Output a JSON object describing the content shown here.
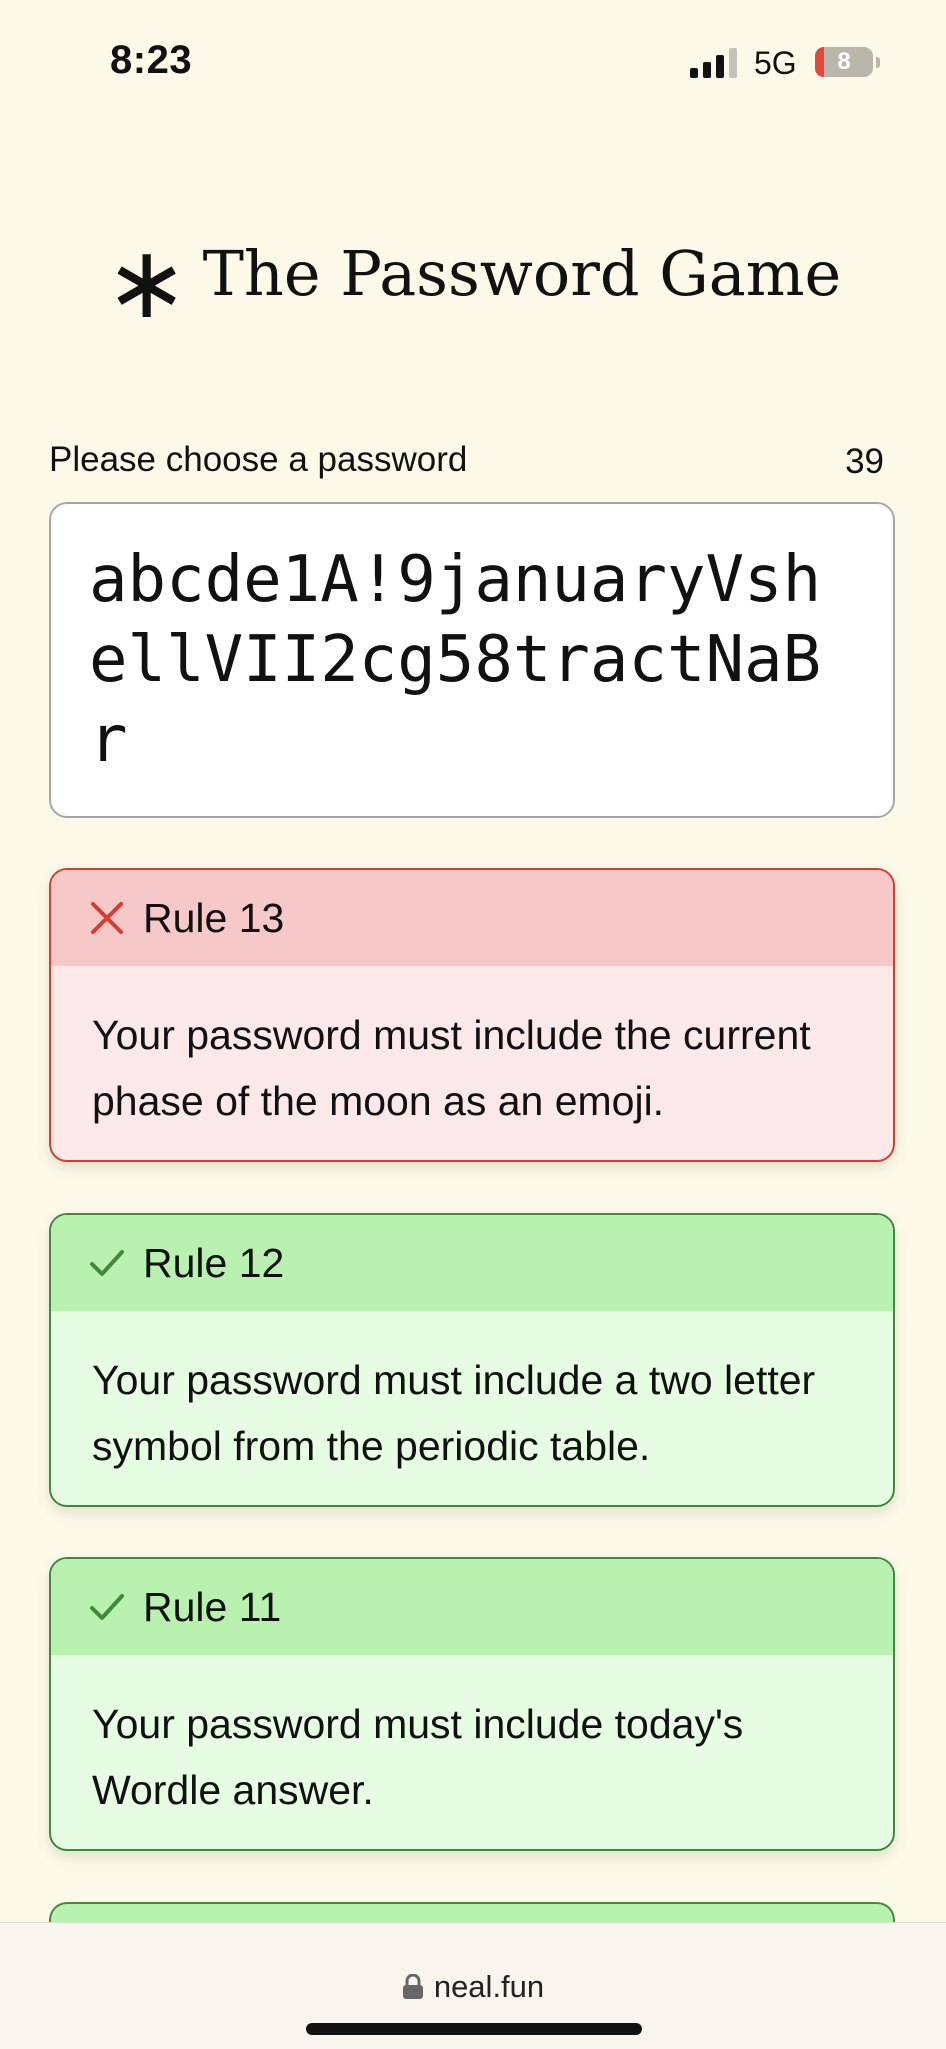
{
  "status": {
    "time": "8:23",
    "network": "5G",
    "battery_level": "8",
    "battery_fraction": 0.08
  },
  "title": {
    "icon": "asterisk-icon",
    "text": "The Password Game"
  },
  "password": {
    "label": "Please choose a password",
    "count": "39",
    "value": "abcde1A!9januaryVshellVII2cg58tractNaBr"
  },
  "rules": [
    {
      "title": "Rule 13",
      "status": "fail",
      "icon": "x-icon",
      "text": "Your password must include the current phase of the moon as an emoji."
    },
    {
      "title": "Rule 12",
      "status": "pass",
      "icon": "check-icon",
      "text": "Your password must include a two letter symbol from the periodic table."
    },
    {
      "title": "Rule 11",
      "status": "pass",
      "icon": "check-icon",
      "text": "Your password must include today's Wordle answer."
    }
  ],
  "colors": {
    "background": "#fdf9e8",
    "fail_border": "#d93b2f",
    "fail_header": "#f6c8c8",
    "pass_border": "#3f8a3d",
    "pass_header": "#b9f1b0"
  },
  "browser": {
    "url": "neal.fun",
    "icon": "lock-icon"
  }
}
